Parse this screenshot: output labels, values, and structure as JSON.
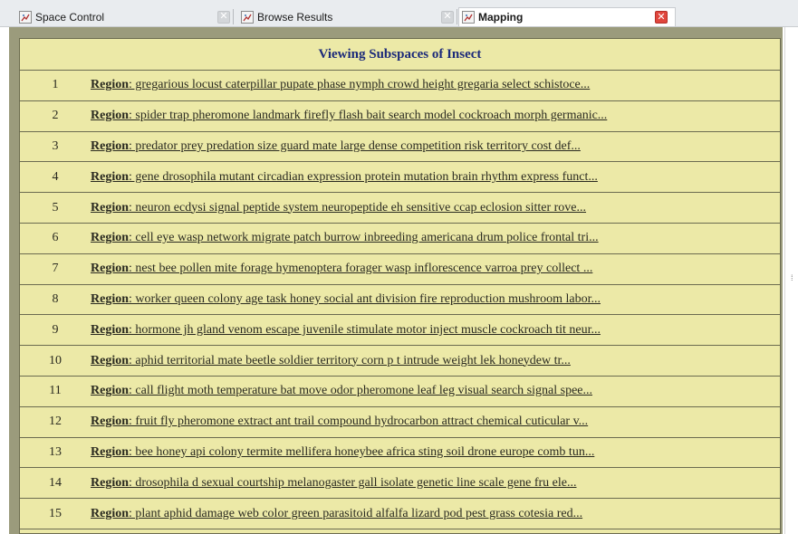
{
  "tabs": [
    {
      "label": "Space Control",
      "icon": "map-chart-icon",
      "active": false
    },
    {
      "label": "Browse Results",
      "icon": "map-chart-icon",
      "active": false
    },
    {
      "label": "Mapping",
      "icon": "map-chart-icon",
      "active": true
    }
  ],
  "close_glyph": "✕",
  "panel": {
    "title": "Viewing Subspaces of Insect",
    "region_label": "Region",
    "rows": [
      {
        "n": "1",
        "text": ":  gregarious locust caterpillar pupate phase nymph crowd height gregaria select schistoce..."
      },
      {
        "n": "2",
        "text": ":  spider trap pheromone landmark firefly flash bait search model cockroach morph germanic..."
      },
      {
        "n": "3",
        "text": ":  predator prey predation size guard mate large dense competition risk territory cost def..."
      },
      {
        "n": "4",
        "text": ":  gene drosophila mutant circadian expression protein mutation brain rhythm express funct..."
      },
      {
        "n": "5",
        "text": ":  neuron ecdysi signal peptide system neuropeptide eh sensitive ccap eclosion sitter rove..."
      },
      {
        "n": "6",
        "text": ":  cell eye wasp network migrate patch burrow inbreeding americana drum police frontal tri..."
      },
      {
        "n": "7",
        "text": ":  nest bee pollen mite forage hymenoptera forager wasp inflorescence varroa prey collect ..."
      },
      {
        "n": "8",
        "text": ":  worker queen colony age task honey social ant division fire reproduction mushroom labor..."
      },
      {
        "n": "9",
        "text": ":  hormone jh gland venom escape juvenile stimulate motor inject muscle cockroach tit neur..."
      },
      {
        "n": "10",
        "text": ":  aphid territorial mate beetle soldier territory corn p t intrude weight lek honeydew tr..."
      },
      {
        "n": "11",
        "text": ":  call flight moth temperature bat move odor pheromone leaf leg visual search signal spee..."
      },
      {
        "n": "12",
        "text": ":  fruit fly pheromone extract ant trail compound hydrocarbon attract chemical cuticular v..."
      },
      {
        "n": "13",
        "text": ":  bee honey api colony termite mellifera honeybee africa sting soil drone europe comb tun..."
      },
      {
        "n": "14",
        "text": ":  drosophila d sexual courtship melanogaster gall isolate genetic line scale gene fru ele..."
      },
      {
        "n": "15",
        "text": ":  plant aphid damage web color green parasitoid alfalfa lizard pod pest grass cotesia red..."
      }
    ]
  },
  "colors": {
    "panel_bg": "#ece9a7",
    "frame_bg": "#9b9b7c",
    "title_color": "#1c2a7a",
    "active_close": "#e0463d"
  },
  "scroll_glyph": "⁞"
}
